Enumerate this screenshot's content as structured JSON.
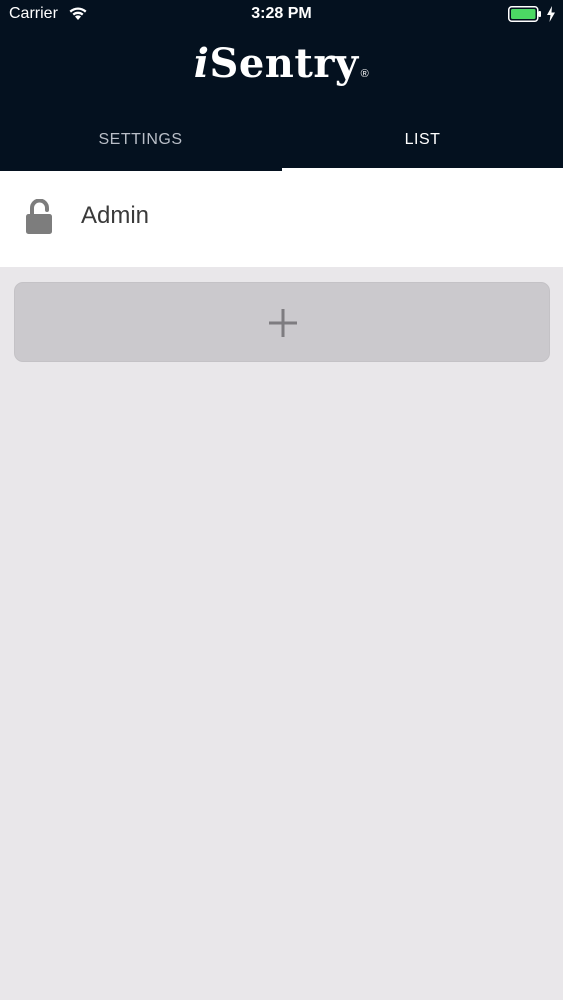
{
  "status_bar": {
    "carrier": "Carrier",
    "time": "3:28 PM",
    "battery_color": "#4cd964"
  },
  "app": {
    "logo_prefix": "i",
    "logo_main": "Sentry",
    "logo_mark": "®",
    "header_color": "#04111f"
  },
  "tabs": [
    {
      "label": "SETTINGS",
      "active": false
    },
    {
      "label": "LIST",
      "active": true
    }
  ],
  "list": {
    "items": [
      {
        "label": "Admin",
        "icon": "unlock-icon"
      }
    ]
  },
  "add_button": {
    "icon": "plus-icon"
  }
}
